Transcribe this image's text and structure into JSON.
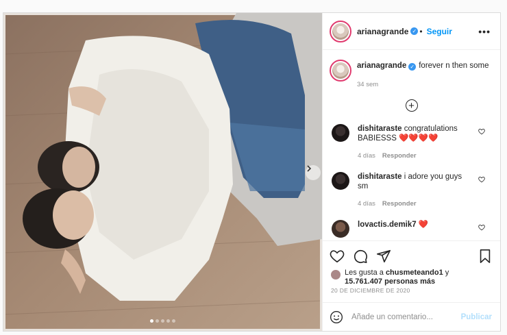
{
  "post": {
    "username": "arianagrande",
    "follow_label": "Seguir",
    "more_label": "•••",
    "caption": "forever n then some",
    "caption_age": "34 sem",
    "load_more_icon": "plus-circle-icon",
    "comments": [
      {
        "user": "dishitaraste",
        "text": "congratulations BABIESSS ❤️❤️❤️❤️",
        "age": "4 días",
        "reply": "Responder"
      },
      {
        "user": "dishitaraste",
        "text": "i adore you guys sm",
        "age": "4 días",
        "reply": "Responder"
      },
      {
        "user": "lovactis.demik7",
        "text": "❤️"
      }
    ],
    "likes_prefix": "Les gusta a",
    "likes_user": "chusmeteando1",
    "likes_joiner": "y",
    "likes_count": "15.761.407 personas más",
    "date": "20 DE DICIEMBRE DE 2020",
    "comment_placeholder": "Añade un comentario...",
    "publish_label": "Publicar",
    "carousel": {
      "count": 5,
      "active": 0
    },
    "icons": {
      "like": "heart-icon",
      "comment": "comment-icon",
      "share": "send-icon",
      "save": "bookmark-icon",
      "emoji": "emoji-icon",
      "next": "chevron-right-icon",
      "verified": "verified-badge-icon"
    },
    "colors": {
      "link_blue": "#0095f6",
      "verified": "#3897f0",
      "muted": "#8e8e8e",
      "publish_disabled": "#b2dffc"
    }
  }
}
